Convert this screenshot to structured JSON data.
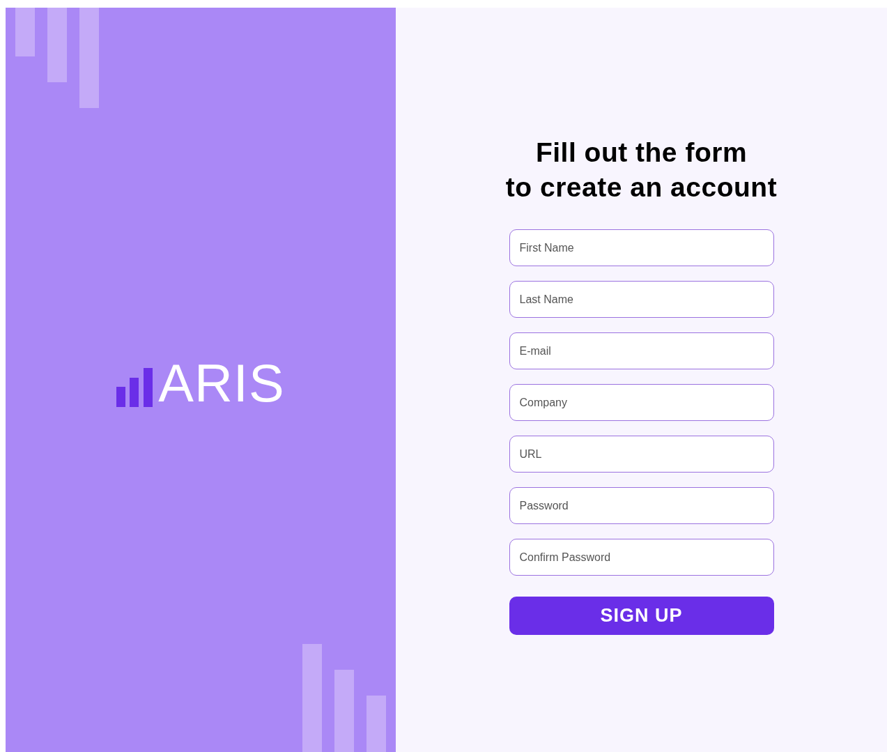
{
  "brand": {
    "logo_text": "ARIS"
  },
  "form": {
    "heading_lines": [
      "Fill out the form",
      "to create an account"
    ],
    "fields": [
      {
        "placeholder": "First Name"
      },
      {
        "placeholder": "Last Name"
      },
      {
        "placeholder": "E-mail"
      },
      {
        "placeholder": "Company"
      },
      {
        "placeholder": "URL"
      },
      {
        "placeholder": "Password"
      },
      {
        "placeholder": "Confirm Password"
      }
    ],
    "submit_button": "SIGN UP"
  }
}
